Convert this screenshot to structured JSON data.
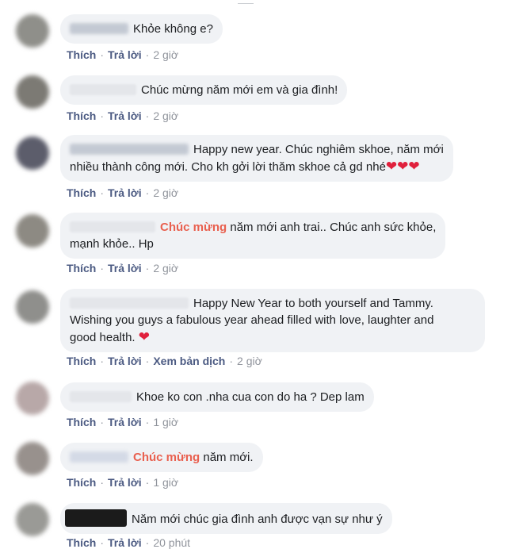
{
  "comments": [
    {
      "text": "Khỏe không e?",
      "actions": {
        "like": "Thích",
        "reply": "Trả lời",
        "time": "2 giờ"
      }
    },
    {
      "text": "Chúc mừng năm mới em và gia đình!",
      "actions": {
        "like": "Thích",
        "reply": "Trả lời",
        "time": "2 giờ"
      }
    },
    {
      "text_line1": "Happy new year. Chúc nghiêm skhoe, năm mới",
      "text_line2": "nhiều thành công mới. Cho kh gởi lời thăm skhoe cả gd nhé",
      "hearts": "❤❤❤",
      "actions": {
        "like": "Thích",
        "reply": "Trả lời",
        "time": "2 giờ"
      }
    },
    {
      "mention": "Chúc mừng",
      "text_line1": "năm mới anh trai.. Chúc anh sức khỏe,",
      "text_line2": "mạnh khỏe.. Hp",
      "actions": {
        "like": "Thích",
        "reply": "Trả lời",
        "time": "2 giờ"
      }
    },
    {
      "text_line1": "Happy New Year to both yourself and Tammy.",
      "text_line2": "Wishing you guys a fabulous year ahead filled with love, laughter and",
      "text_line3": "good health.",
      "hearts": "❤",
      "actions": {
        "like": "Thích",
        "reply": "Trả lời",
        "translate": "Xem bản dịch",
        "time": "2 giờ"
      }
    },
    {
      "text": "Khoe ko con .nha cua con do ha ? Dep lam",
      "actions": {
        "like": "Thích",
        "reply": "Trả lời",
        "time": "1 giờ"
      }
    },
    {
      "mention": "Chúc mừng",
      "text": "năm mới.",
      "actions": {
        "like": "Thích",
        "reply": "Trả lời",
        "time": "1 giờ"
      }
    },
    {
      "text": "Năm mới chúc gia đình anh được vạn sự như ý",
      "actions": {
        "like": "Thích",
        "reply": "Trả lời",
        "time": "20 phút"
      }
    }
  ],
  "colors": {
    "bubble": "#f0f2f5",
    "action_link": "#4b5a82",
    "mention": "#e9604f",
    "heart": "#e0203c"
  }
}
